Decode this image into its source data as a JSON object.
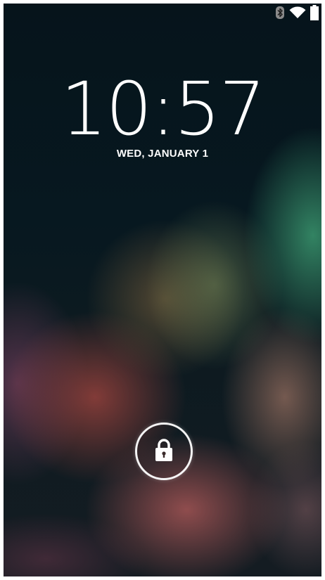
{
  "lockscreen": {
    "time": "10:57",
    "date": "WED, JANUARY 1"
  },
  "status_bar": {
    "icons": [
      "bluetooth-icon",
      "wifi-icon",
      "battery-icon"
    ]
  },
  "unlock": {
    "icon": "lock-icon"
  },
  "colors": {
    "text": "#ffffff",
    "background": "#06131a"
  }
}
